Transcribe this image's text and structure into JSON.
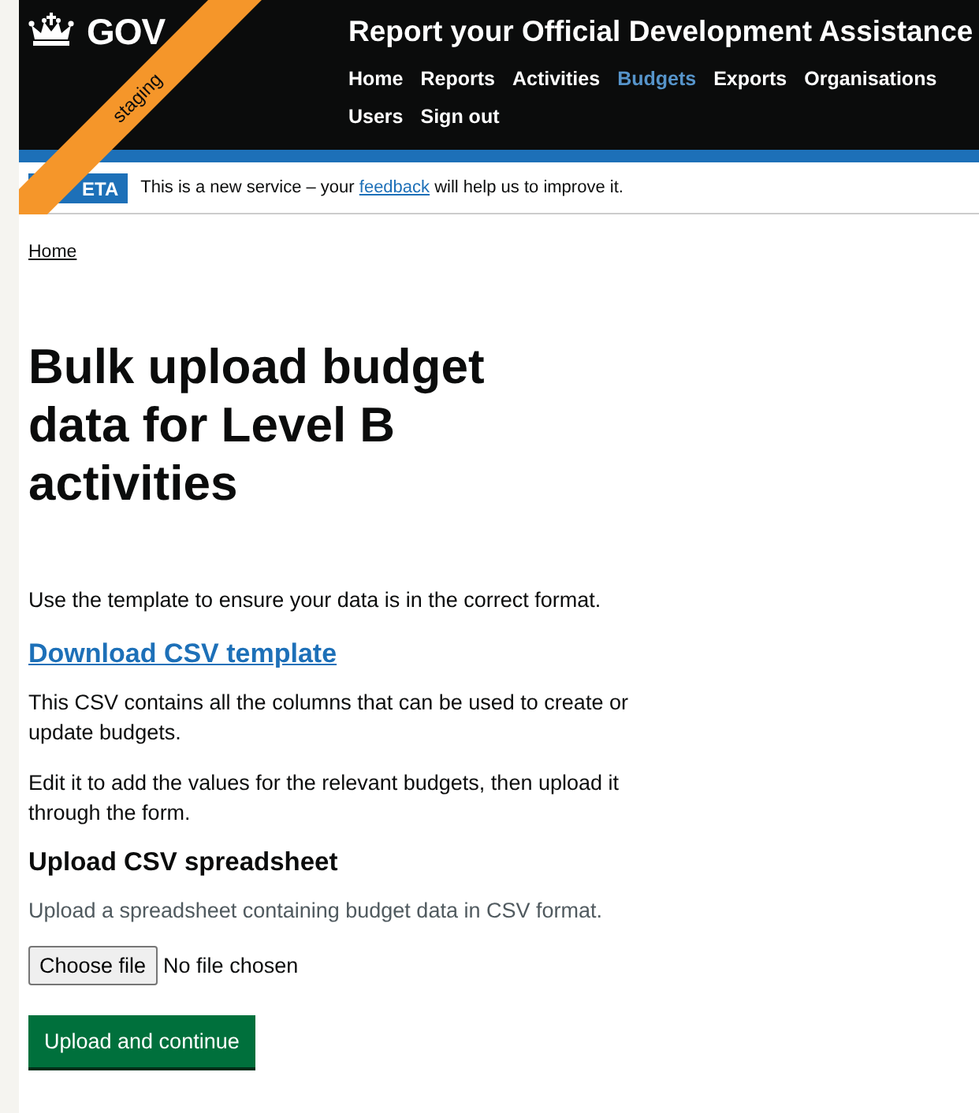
{
  "header": {
    "logo_text": "GOV",
    "ribbon": "staging",
    "service_name": "Report your Official Development Assistance",
    "nav": [
      {
        "label": "Home",
        "selected": false
      },
      {
        "label": "Reports",
        "selected": false
      },
      {
        "label": "Activities",
        "selected": false
      },
      {
        "label": "Budgets",
        "selected": true
      },
      {
        "label": "Exports",
        "selected": false
      },
      {
        "label": "Organisations",
        "selected": false
      },
      {
        "label": "Users",
        "selected": false
      },
      {
        "label": "Sign out",
        "selected": false
      }
    ]
  },
  "phase_banner": {
    "tag": "ETA",
    "before": "This is a new service – your ",
    "link": "feedback",
    "after": " will help us to improve it."
  },
  "breadcrumb": "Home",
  "heading": "Bulk upload budget data for Level B activities",
  "intro": "Use the template to ensure your data is in the correct format.",
  "download_link": "Download CSV template",
  "paragraphs": [
    "This CSV contains all the columns that can be used to create or update budgets.",
    "Edit it to add the values for the relevant budgets, then upload it through the form."
  ],
  "upload": {
    "label": "Upload CSV spreadsheet",
    "hint": "Upload a spreadsheet containing budget data in CSV format.",
    "choose_button": "Choose file",
    "file_status": "No file chosen"
  },
  "submit": "Upload and continue"
}
